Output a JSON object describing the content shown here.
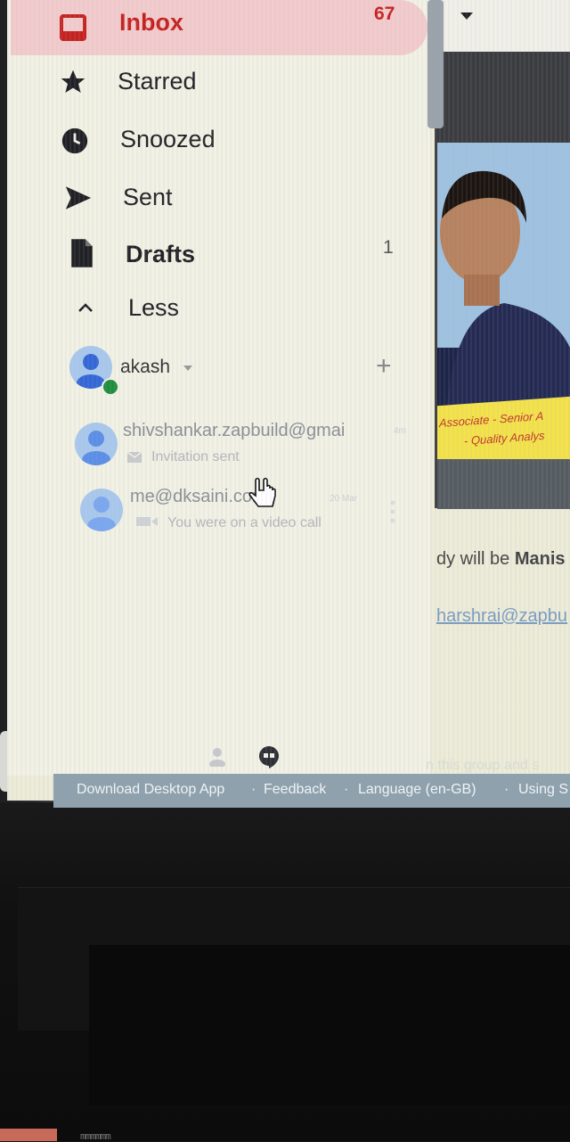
{
  "nav": {
    "inbox": {
      "label": "Inbox",
      "count": "67"
    },
    "starred": {
      "label": "Starred"
    },
    "snoozed": {
      "label": "Snoozed"
    },
    "sent": {
      "label": "Sent"
    },
    "drafts": {
      "label": "Drafts",
      "count": "1"
    },
    "less": {
      "label": "Less"
    }
  },
  "hangouts": {
    "me": {
      "name": "akash",
      "add": "+"
    },
    "conversations": [
      {
        "name": "shivshankar.zapbuild@gmai",
        "status": "Invitation sent",
        "time": "4m"
      },
      {
        "name": "me@dksaini.com",
        "status": "You were on a video call",
        "time": "20 Mar"
      }
    ]
  },
  "footer": {
    "download": "Download Desktop App",
    "feedback": "Feedback",
    "language": "Language (en-GB)",
    "using": "Using S",
    "sep": "·",
    "faded": "n this group and s"
  },
  "email": {
    "line1_prefix": "dy will be ",
    "line1_bold": "Manis",
    "link": "harshrai@zapbu",
    "banner_line1": "Associate - Senior A",
    "banner_line2": "- Quality Analys"
  },
  "colors": {
    "inbox_highlight": "#f2cccc",
    "inbox_text": "#c5221f",
    "presence": "#1e8e3e"
  },
  "desk": {
    "scribble": "mmmmmm"
  }
}
